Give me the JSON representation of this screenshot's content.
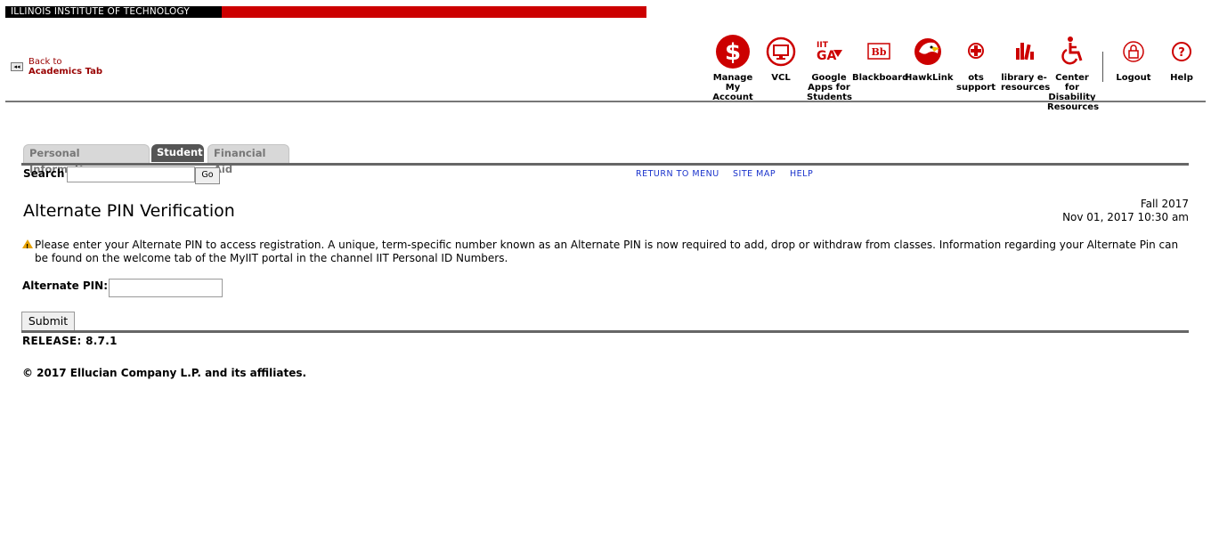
{
  "banner": {
    "text": "ILLINOIS INSTITUTE OF TECHNOLOGY"
  },
  "back_link": {
    "line1": "Back to",
    "line2": "Academics Tab"
  },
  "nav": [
    {
      "label": "Manage My Account",
      "icon": "dollar-icon"
    },
    {
      "label": "VCL",
      "icon": "monitor-icon"
    },
    {
      "label": "Google Apps for Students",
      "icon": "google-apps-icon"
    },
    {
      "label": "Blackboard",
      "icon": "blackboard-icon"
    },
    {
      "label": "HawkLink",
      "icon": "hawk-icon"
    },
    {
      "label": "ots support",
      "icon": "support-cross-icon"
    },
    {
      "label": "library e-resources",
      "icon": "library-books-icon"
    },
    {
      "label": "Center for Disability Resources",
      "icon": "wheelchair-icon"
    },
    {
      "label": "Logout",
      "icon": "lock-icon"
    },
    {
      "label": "Help",
      "icon": "help-icon"
    }
  ],
  "tabs": [
    {
      "label": "Personal Information",
      "active": false
    },
    {
      "label": "Student",
      "active": true
    },
    {
      "label": "Financial Aid",
      "active": false
    }
  ],
  "search": {
    "label": "Search",
    "value": "",
    "go_label": "Go"
  },
  "links": [
    "RETURN TO MENU",
    "SITE MAP",
    "HELP"
  ],
  "page": {
    "title": "Alternate PIN Verification",
    "term": "Fall 2017",
    "datetime": "Nov 01, 2017 10:30 am",
    "info": "Please enter your Alternate PIN to access registration. A unique, term-specific number known as an Alternate PIN is now required to add, drop or withdraw from classes. Information regarding your Alternate Pin can be found on the welcome tab of the MyIIT portal in the channel IIT Personal ID Numbers.",
    "pin_label": "Alternate PIN:",
    "pin_value": "",
    "submit_label": "Submit"
  },
  "footer": {
    "release": "RELEASE: 8.7.1",
    "copyright": "© 2017 Ellucian Company L.P. and its affiliates."
  },
  "colors": {
    "brand_red": "#cc0000",
    "link_blue": "#1a33cc",
    "back_red": "#990000"
  }
}
